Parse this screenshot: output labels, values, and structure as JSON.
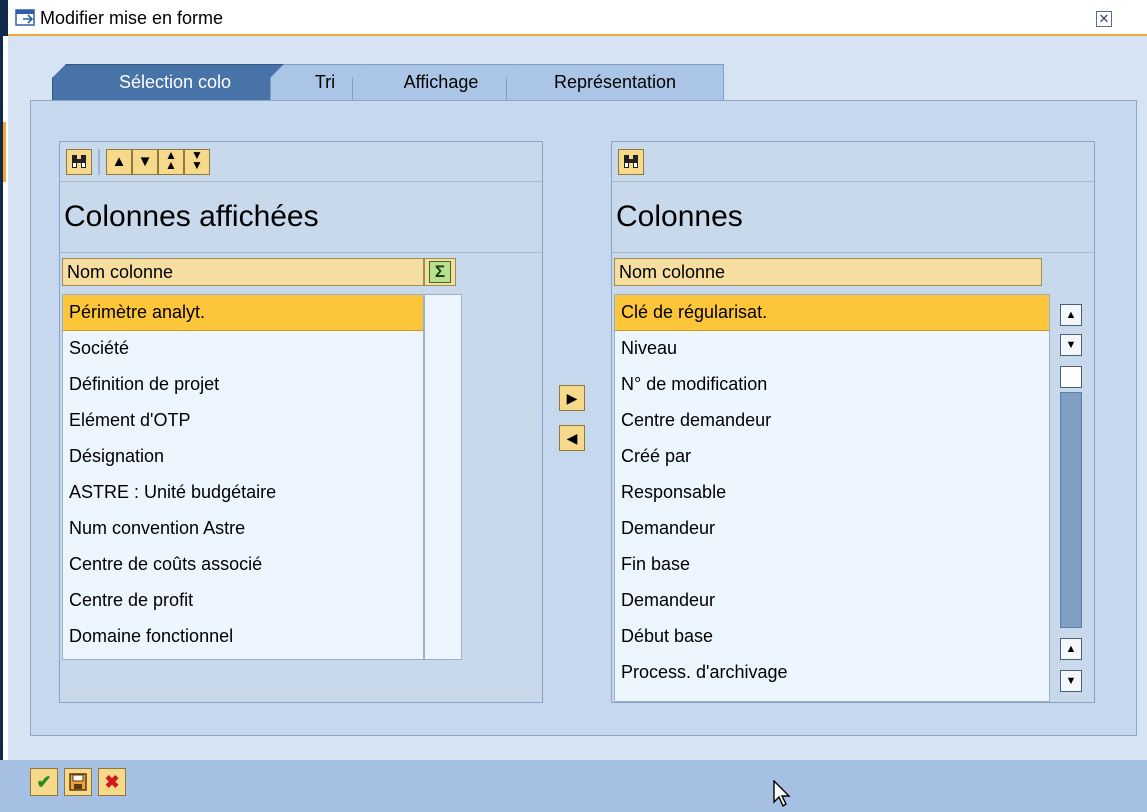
{
  "window": {
    "title": "Modifier mise en forme",
    "close_icon": "close-icon"
  },
  "tabs": [
    {
      "label": "Sélection colo",
      "active": true
    },
    {
      "label": "Tri",
      "active": false
    },
    {
      "label": "Affichage",
      "active": false
    },
    {
      "label": "Représentation",
      "active": false
    }
  ],
  "left_panel": {
    "heading": "Colonnes affichées",
    "toolbar_icons": [
      "find-icon",
      "move-up-icon",
      "move-down-icon",
      "move-top-icon",
      "move-bottom-icon"
    ],
    "column_header": "Nom colonne",
    "sum_icon": "sigma-icon",
    "rows": [
      "Périmètre analyt.",
      "Société",
      "Définition de projet",
      "Elément d'OTP",
      "Désignation",
      "ASTRE : Unité budgétaire",
      "Num convention Astre",
      "Centre de coûts associé",
      "Centre de profit",
      "Domaine fonctionnel"
    ],
    "selected_index": 0
  },
  "transfer_buttons": [
    "move-right-icon",
    "move-left-icon"
  ],
  "right_panel": {
    "heading": "Colonnes",
    "toolbar_icons": [
      "find-icon"
    ],
    "column_header": "Nom colonne",
    "rows": [
      "Clé de régularisat.",
      "Niveau",
      "N° de modification",
      "Centre demandeur",
      "Créé par",
      "Responsable",
      "Demandeur",
      "Fin base",
      "Demandeur",
      "Début base",
      "Process. d'archivage"
    ],
    "selected_index": 0
  },
  "footer_buttons": [
    "confirm-icon",
    "save-icon",
    "cancel-icon"
  ],
  "colors": {
    "selection": "#fcc53a",
    "tab_active": "#4873a8",
    "footer": "#a5c0e3"
  }
}
